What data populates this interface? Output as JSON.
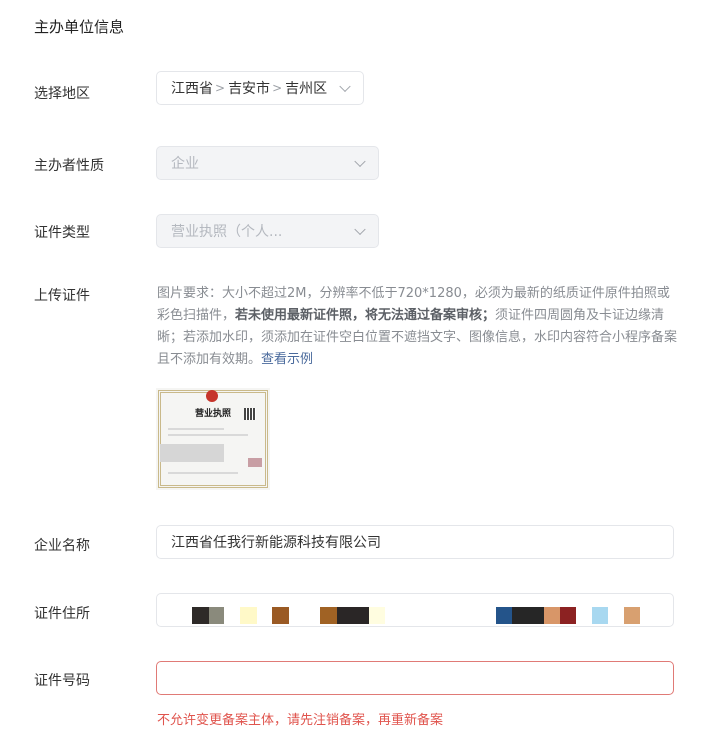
{
  "section_title": "主办单位信息",
  "region": {
    "label": "选择地区",
    "province": "江西省",
    "city": "吉安市",
    "district": "吉州区"
  },
  "nature": {
    "label": "主办者性质",
    "value": "企业"
  },
  "cert_type": {
    "label": "证件类型",
    "value": "营业执照（个人..."
  },
  "upload": {
    "label": "上传证件",
    "hint_part1": "图片要求：大小不超过2M，分辨率不低于720*1280，必须为最新的纸质证件原件拍照或彩色扫描件，",
    "hint_bold": "若未使用最新证件照，将无法通过备案审核；",
    "hint_part2": "须证件四周圆角及卡证边缘清晰；若添加水印，须添加在证件空白位置不遮挡文字、图像信息，水印内容符合小程序备案且不添加有效期。",
    "hint_link": "查看示例",
    "preview_title": "营业执照"
  },
  "company_name": {
    "label": "企业名称",
    "value": "江西省任我行新能源科技有限公司"
  },
  "address": {
    "label": "证件住所",
    "mosaic_colors": [
      "#2e2a28",
      "#8a8a7c",
      "#fff9c8",
      "#9a5a24",
      "#a06224",
      "#2a2626",
      "#fffde0",
      "#24548a",
      "#262626",
      "#d89668",
      "#8c2222",
      "#a8d8f0",
      "#d8a070"
    ]
  },
  "id_number": {
    "label": "证件号码",
    "value": "",
    "error": "不允许变更备案主体，请先注销备案，再重新备案"
  },
  "colors": {
    "error": "#e0544d",
    "link": "#4a6a9c",
    "border": "#e4e6ea",
    "disabled_bg": "#f3f4f6"
  }
}
